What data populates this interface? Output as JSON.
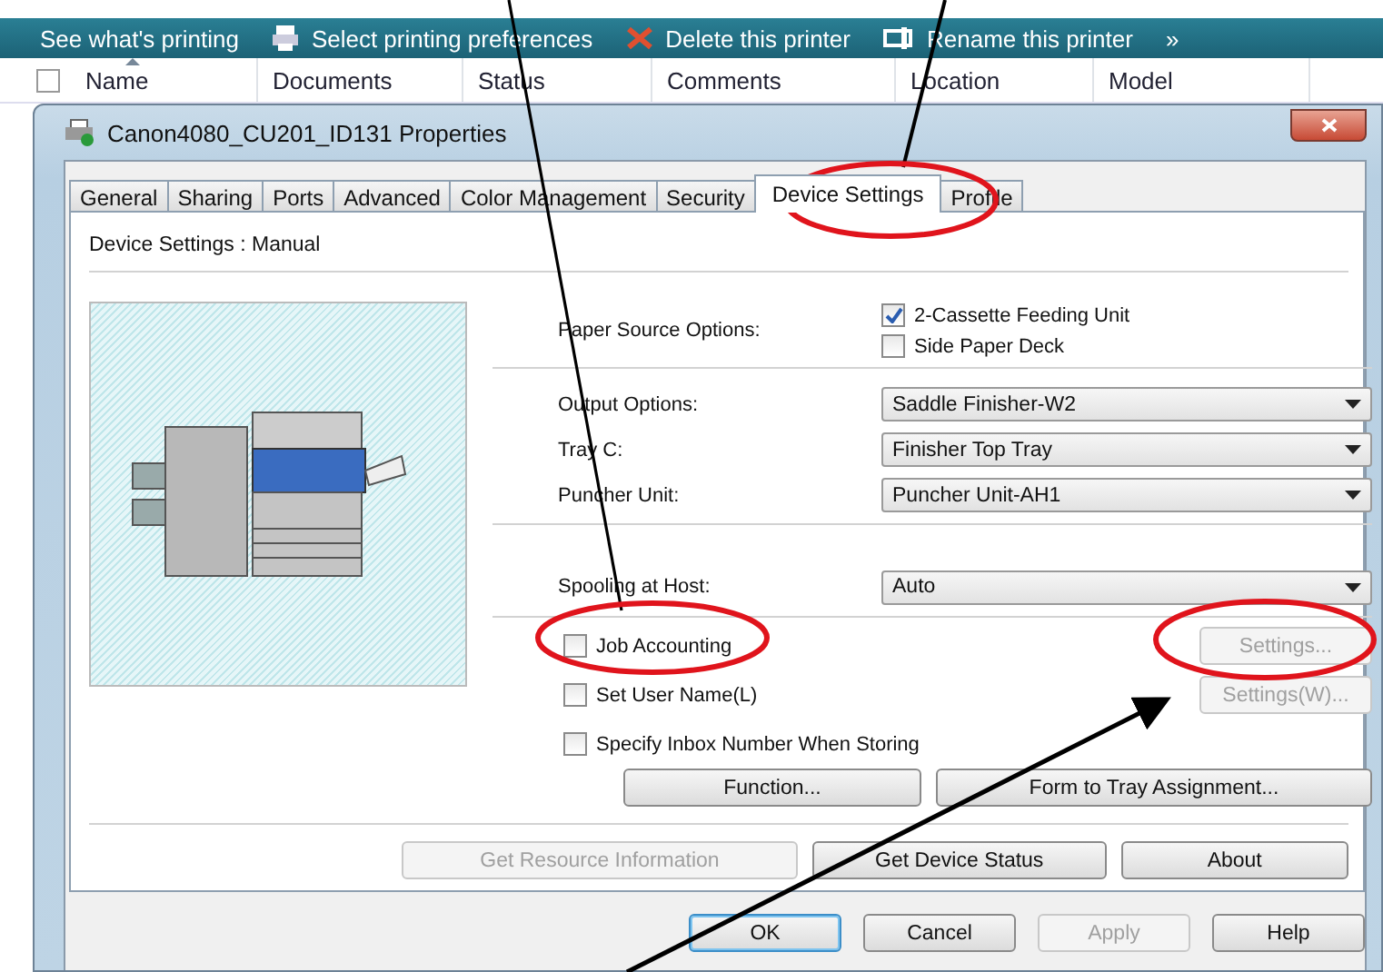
{
  "toolbar": {
    "items": [
      {
        "label": "See what's printing"
      },
      {
        "label": "Select printing preferences"
      },
      {
        "label": "Delete this printer"
      },
      {
        "label": "Rename this printer"
      },
      {
        "label": "»"
      }
    ]
  },
  "select_all": {
    "checked": false
  },
  "columns": [
    {
      "label": "Name",
      "sorted": true
    },
    {
      "label": "Documents",
      "sorted": false
    },
    {
      "label": "Status",
      "sorted": false
    },
    {
      "label": "Comments",
      "sorted": false
    },
    {
      "label": "Location",
      "sorted": false
    },
    {
      "label": "Model",
      "sorted": false
    }
  ],
  "dialog": {
    "title": "Canon4080_CU201_ID131 Properties",
    "tabs": [
      {
        "label": "General",
        "selected": false
      },
      {
        "label": "Sharing",
        "selected": false
      },
      {
        "label": "Ports",
        "selected": false
      },
      {
        "label": "Advanced",
        "selected": false
      },
      {
        "label": "Color Management",
        "selected": false
      },
      {
        "label": "Security",
        "selected": false
      },
      {
        "label": "Device Settings",
        "selected": true
      },
      {
        "label": "Profile",
        "selected": false
      }
    ],
    "heading": "Device Settings : Manual",
    "paper_source": {
      "label": "Paper Source Options:",
      "options": [
        {
          "label": "2-Cassette Feeding Unit",
          "checked": true
        },
        {
          "label": "Side Paper Deck",
          "checked": false
        }
      ]
    },
    "selects": [
      {
        "label": "Output Options:",
        "value": "Saddle Finisher-W2"
      },
      {
        "label": "Tray C:",
        "value": "Finisher Top Tray"
      },
      {
        "label": "Puncher Unit:",
        "value": "Puncher Unit-AH1"
      }
    ],
    "spooling": {
      "label": "Spooling at Host:",
      "value": "Auto"
    },
    "checks": [
      {
        "label": "Job Accounting",
        "checked": false,
        "button": {
          "label": "Settings...",
          "disabled": true
        }
      },
      {
        "label": "Set User Name(L)",
        "checked": false,
        "button": {
          "label": "Settings(W)...",
          "disabled": true
        }
      },
      {
        "label": "Specify Inbox Number When Storing",
        "checked": false
      }
    ],
    "function_buttons": [
      {
        "label": "Function...",
        "disabled": false
      },
      {
        "label": "Form to Tray Assignment...",
        "disabled": false
      }
    ],
    "info_buttons": [
      {
        "label": "Get Resource Information",
        "disabled": true
      },
      {
        "label": "Get Device Status",
        "disabled": false
      },
      {
        "label": "About",
        "disabled": false
      }
    ],
    "footer_buttons": [
      {
        "label": "OK",
        "disabled": false,
        "default": true
      },
      {
        "label": "Cancel",
        "disabled": false,
        "default": false
      },
      {
        "label": "Apply",
        "disabled": true,
        "default": false
      },
      {
        "label": "Help",
        "disabled": false,
        "default": false
      }
    ]
  }
}
